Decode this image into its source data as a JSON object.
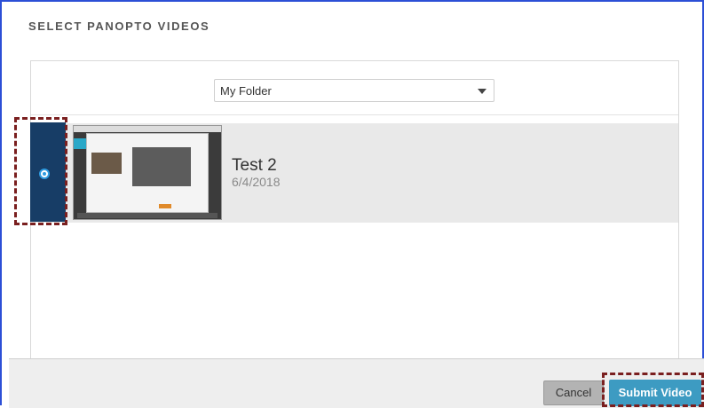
{
  "dialog": {
    "title": "SELECT PANOPTO VIDEOS"
  },
  "folder_select": {
    "selected": "My Folder"
  },
  "videos": [
    {
      "title": "Test 2",
      "date": "6/4/2018",
      "selected": true
    }
  ],
  "footer": {
    "cancel_label": "Cancel",
    "submit_label": "Submit Video"
  },
  "colors": {
    "accent": "#3d9bc2",
    "selection": "#173d66",
    "highlight_border": "#7a1f1f",
    "frame": "#2c4fd6"
  }
}
